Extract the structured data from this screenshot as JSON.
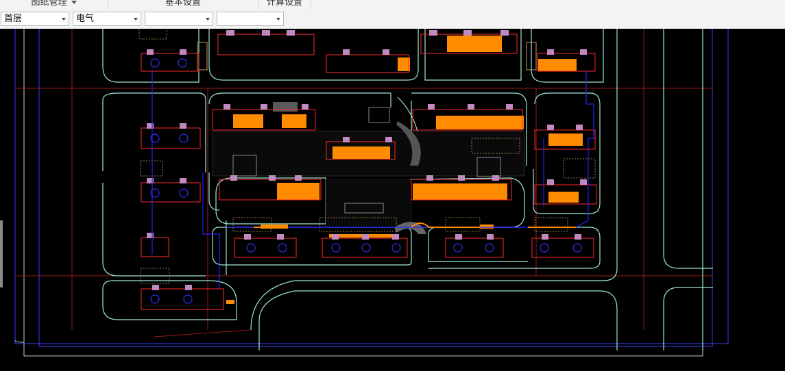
{
  "menu": {
    "tabs": [
      {
        "label": "图纸管理",
        "has_dropdown": true
      },
      {
        "label": "基本设置",
        "has_dropdown": false
      },
      {
        "label": "计算设置",
        "has_dropdown": false
      }
    ]
  },
  "filters": {
    "floor": "首层",
    "discipline": "电气",
    "filter3": "",
    "filter4": ""
  },
  "colors": {
    "background": "#000000",
    "road_outline": "#9fe8d2",
    "grid_line": "#9a1a1a",
    "boundary": "#3c3cff",
    "building_fill": "#ff8c00",
    "pipe": "#2222ff",
    "component": "#c03cc0"
  },
  "icons": [
    "chevron-down-icon"
  ]
}
